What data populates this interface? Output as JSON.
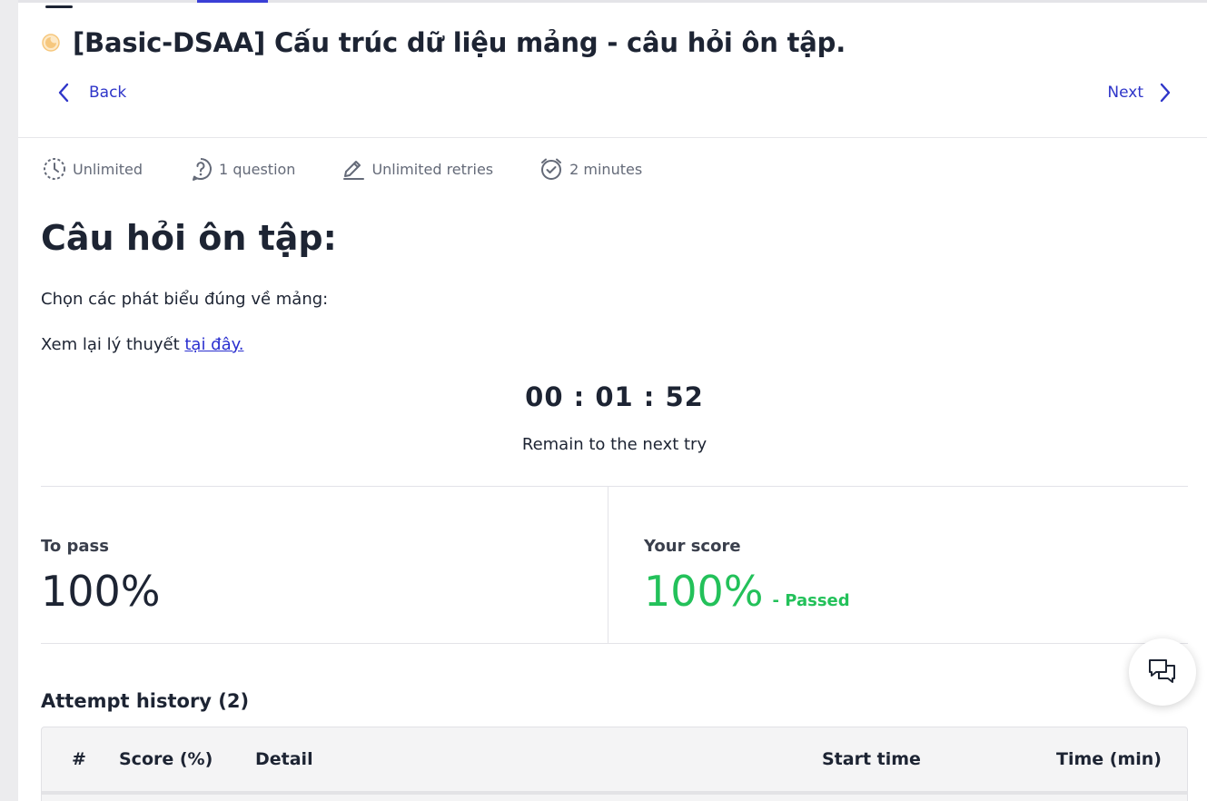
{
  "lesson": {
    "title": "[Basic-DSAA] Cấu trúc dữ liệu mảng - câu hỏi ôn tập."
  },
  "nav": {
    "back_label": "Back",
    "next_label": "Next"
  },
  "meta": {
    "time_limit": "Unlimited",
    "question_count": "1 question",
    "retries": "Unlimited retries",
    "duration": "2 minutes"
  },
  "content": {
    "heading": "Câu hỏi ôn tập:",
    "prompt": "Chọn các phát biểu đúng về mảng:",
    "review_prefix": "Xem lại lý thuyết ",
    "review_link": "tại đây."
  },
  "timer": {
    "value": "00 : 01 : 52",
    "caption": "Remain to the next try"
  },
  "scores": {
    "to_pass_label": "To pass",
    "to_pass_value": "100%",
    "your_score_label": "Your score",
    "your_score_value": "100%",
    "status": "- Passed"
  },
  "history": {
    "title": "Attempt history (2)",
    "columns": [
      "#",
      "Score (%)",
      "Detail",
      "Start time",
      "Time (min)"
    ]
  },
  "colors": {
    "accent": "#2e35c9",
    "passed": "#23c15a",
    "status_dot": "#f6c77d"
  },
  "icons": {
    "time_limit": "clock-dashed-icon",
    "question_count": "question-bubble-icon",
    "retries": "pencil-edit-icon",
    "duration": "alarm-check-icon",
    "chat": "chat-bubbles-icon"
  }
}
